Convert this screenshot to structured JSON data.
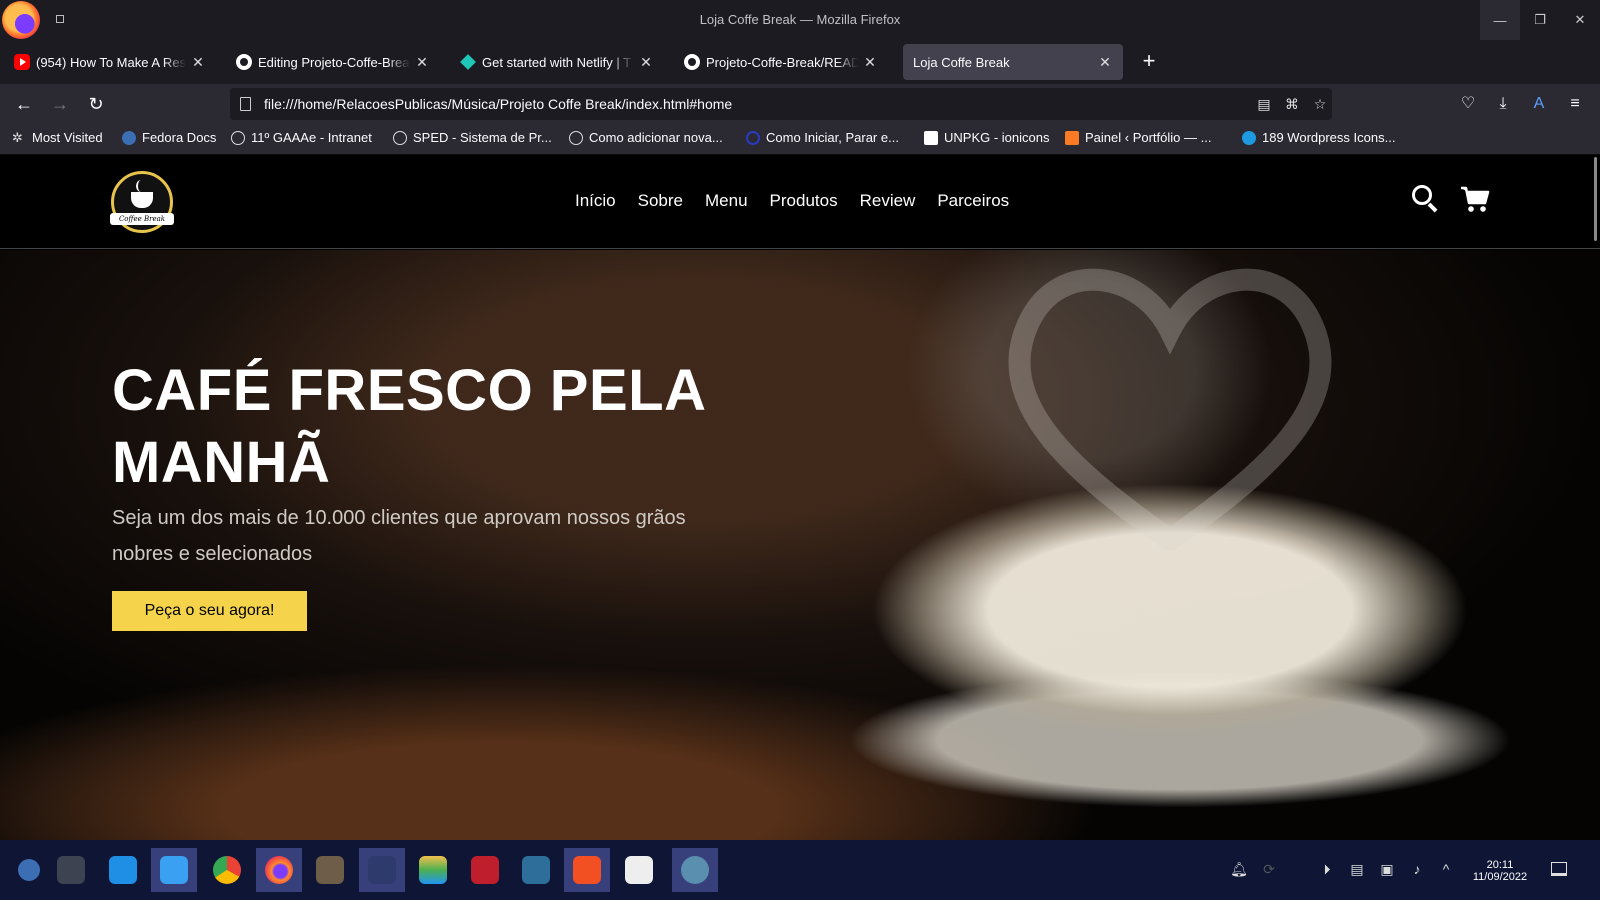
{
  "window": {
    "title": "Loja Coffe Break — Mozilla Firefox"
  },
  "tabs": [
    {
      "title": "(954) How To Make A Respo",
      "favicon": "youtube-icon",
      "active": false
    },
    {
      "title": "Editing Projeto-Coffe-Break",
      "favicon": "github-icon",
      "active": false
    },
    {
      "title": "Get started with Netlify | T",
      "favicon": "netlify-icon",
      "active": false
    },
    {
      "title": "Projeto-Coffe-Break/READM",
      "favicon": "github-icon",
      "active": false
    },
    {
      "title": "Loja Coffe Break",
      "favicon": "none",
      "active": true
    }
  ],
  "navbar": {
    "url": "file:///home/RelacoesPublicas/Música/Projeto Coffe Break/index.html#home"
  },
  "bookmarks": [
    {
      "label": "Most Visited",
      "icon": "gear-icon"
    },
    {
      "label": "Fedora Docs",
      "icon": "fedora-icon"
    },
    {
      "label": "11º GAAAe - Intranet",
      "icon": "globe-icon"
    },
    {
      "label": "SPED - Sistema de Pr...",
      "icon": "globe-icon"
    },
    {
      "label": "Como adicionar nova...",
      "icon": "globe-icon"
    },
    {
      "label": "Como Iniciar, Parar e...",
      "icon": "circle-icon"
    },
    {
      "label": "UNPKG - ionicons",
      "icon": "unpkg-icon"
    },
    {
      "label": "Painel ‹ Portfólio — ...",
      "icon": "xampp-icon"
    },
    {
      "label": "189 Wordpress Icons...",
      "icon": "search-site-icon"
    }
  ],
  "site": {
    "logo_text": "Coffee Break",
    "nav": [
      "Início",
      "Sobre",
      "Menu",
      "Produtos",
      "Review",
      "Parceiros"
    ],
    "hero": {
      "title": "CAFÉ FRESCO PELA MANHÃ",
      "subtitle": "Seja um dos mais de 10.000 clientes que aprovam nossos grãos nobres e selecionados",
      "cta": "Peça o seu agora!"
    },
    "colors": {
      "accent": "#f5d44c",
      "background": "#000000"
    }
  },
  "taskbar": {
    "time": "20:11",
    "date": "11/09/2022"
  }
}
